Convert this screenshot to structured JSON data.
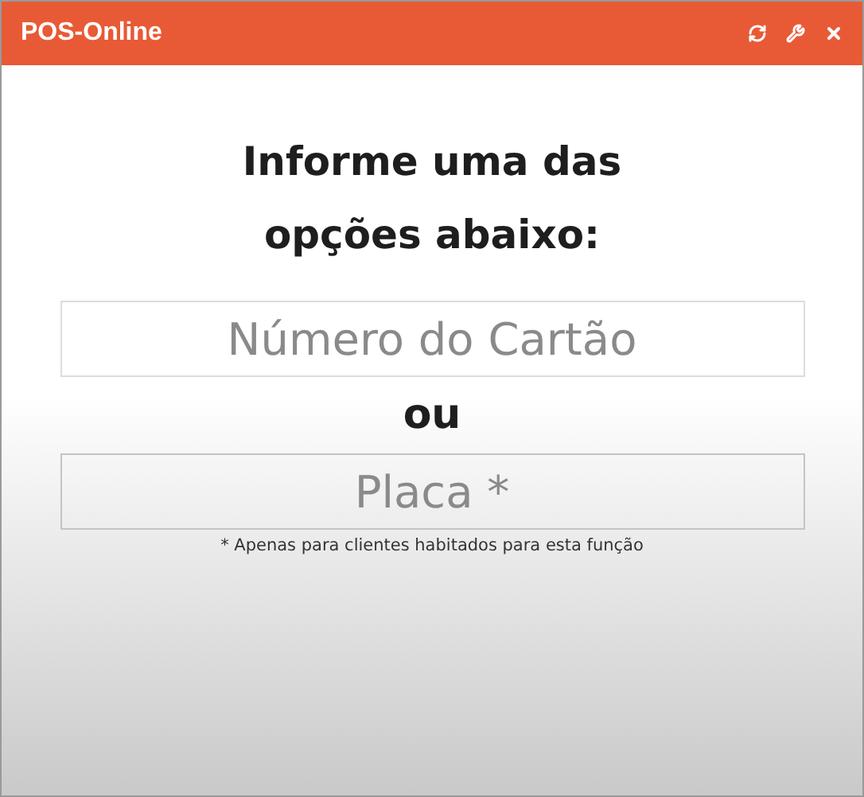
{
  "window": {
    "title": "POS-Online"
  },
  "heading": "Informe uma das opções abaixo:",
  "fields": [
    {
      "placeholder": "Número do Cartão",
      "disabled": false
    },
    {
      "placeholder": "Placa *",
      "disabled": true
    }
  ],
  "separator": "ou",
  "note": "* Apenas para clientes habitados para esta função"
}
